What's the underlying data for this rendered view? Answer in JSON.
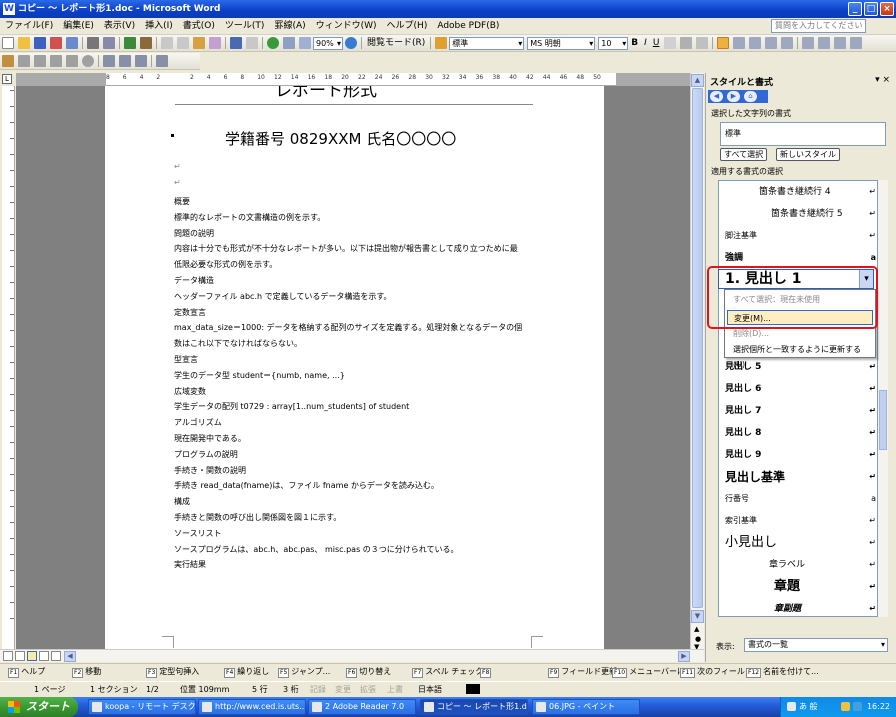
{
  "window": {
    "title": "コピー ～ レポート形1.doc - Microsoft Word"
  },
  "menubar": {
    "items": [
      "ファイル(F)",
      "編集(E)",
      "表示(V)",
      "挿入(I)",
      "書式(O)",
      "ツール(T)",
      "罫線(A)",
      "ウィンドウ(W)",
      "ヘルプ(H)",
      "Adobe PDF(B)"
    ],
    "help_placeholder": "質問を入力してください"
  },
  "toolbar": {
    "zoom": "90%",
    "reading_mode": "閲覧モード(R)",
    "style": "標準",
    "font": "MS 明朝",
    "font_size": "10",
    "bold": "B",
    "italic": "I",
    "underline": "U"
  },
  "ruler": {
    "numbers": [
      "8",
      "6",
      "4",
      "2",
      "",
      "2",
      "4",
      "6",
      "8",
      "10",
      "12",
      "14",
      "16",
      "18",
      "20",
      "22",
      "24",
      "26",
      "28",
      "30",
      "32",
      "34",
      "36",
      "38",
      "40",
      "42",
      "44",
      "46",
      "48",
      "50"
    ]
  },
  "document": {
    "title": "レポート形式",
    "subtitle": "学籍番号 0829XXM  氏名〇〇〇〇",
    "lines": [
      "概要",
      "標準的なレポートの文書構造の例を示す。",
      "問題の説明",
      "内容は十分でも形式が不十分なレポートが多い。以下は提出物が報告書として成り立つために最",
      "低限必要な形式の例を示す。",
      "データ構造",
      "ヘッダーファイル abc.h で定義しているデータ構造を示す。",
      "定数宣言",
      "max_data_size＝1000: データを格納する配列のサイズを定義する。処理対象となるデータの個",
      "数はこれ以下でなければならない。",
      "型宣言",
      "学生のデータ型  student＝{numb, name, ...}",
      "広域変数",
      "学生データの配列  t0729 : array[1..num_students] of student",
      "アルゴリズム",
      "現在開発中である。",
      "プログラムの説明",
      "手続き・関数の説明",
      "手続き read_data(fname)は、ファイル fname からデータを読み込む。",
      "構成",
      "手続きと関数の呼び出し関係図を図１に示す。",
      "ソースリスト",
      "ソースプログラムは、abc.h、abc.pas、 misc.pas の３つに分けられている。",
      "実行結果"
    ]
  },
  "pane": {
    "title": "スタイルと書式",
    "selected_label": "選択した文字列の書式",
    "selected_value": "標準",
    "select_all_btn": "すべて選択",
    "new_style_btn": "新しいスタイル",
    "apply_label": "適用する書式の選択",
    "styles": [
      {
        "name": "箇条書き継続行 4",
        "mark": "↵"
      },
      {
        "name": "箇条書き継続行 5",
        "mark": "↵"
      },
      {
        "name": "脚注基準",
        "mark": "↵"
      },
      {
        "name": "強調",
        "mark": "a"
      },
      {
        "name": "見出し 5",
        "mark": "↵"
      },
      {
        "name": "見出し 6",
        "mark": "↵"
      },
      {
        "name": "見出し 7",
        "mark": "↵"
      },
      {
        "name": "見出し 8",
        "mark": "↵"
      },
      {
        "name": "見出し 9",
        "mark": "↵"
      },
      {
        "name": "見出し基準",
        "mark": "↵"
      },
      {
        "name": "行番号",
        "mark": "a"
      },
      {
        "name": "索引基準",
        "mark": "↵"
      },
      {
        "name": "小見出し",
        "mark": "↵"
      },
      {
        "name": "章ラベル",
        "mark": "↵"
      },
      {
        "name": "章題",
        "mark": "↵"
      },
      {
        "name": "章副題",
        "mark": "↵"
      }
    ],
    "selected_style": "1. 見出し 1",
    "context_menu": {
      "select_all": "すべて選択：現在未使用",
      "change": "変更(M)...",
      "delete": "削除(D)...",
      "update": "選択個所と一致するように更新する(U)"
    },
    "show_label": "表示:",
    "show_value": "書式の一覧"
  },
  "fkeys": [
    {
      "key": "F1",
      "label": "ヘルプ"
    },
    {
      "key": "F2",
      "label": "移動"
    },
    {
      "key": "F3",
      "label": "定型句挿入"
    },
    {
      "key": "F4",
      "label": "繰り返し"
    },
    {
      "key": "F5",
      "label": "ジャンプ..."
    },
    {
      "key": "F6",
      "label": "切り替え"
    },
    {
      "key": "F7",
      "label": "スペル チェック..."
    },
    {
      "key": "F8",
      "label": ""
    },
    {
      "key": "F9",
      "label": "フィールド更新"
    },
    {
      "key": "F10",
      "label": "メニューバーに"
    },
    {
      "key": "F11",
      "label": "次のフィールド"
    },
    {
      "key": "F12",
      "label": "名前を付けて..."
    }
  ],
  "status": {
    "page": "1 ページ",
    "section": "1 セクション",
    "pages": "1/2",
    "position": "位置 109mm",
    "line": "5 行",
    "col": "3 桁",
    "rec": "記録",
    "trk": "変更",
    "ext": "拡張",
    "ovr": "上書",
    "lang": "日本語"
  },
  "taskbar": {
    "start": "スタート",
    "tasks": [
      "koopa - リモート デスク...",
      "http://www.ced.is.uts...",
      "2 Adobe Reader 7.0",
      "コピー ～ レポート形1.d...",
      "06.JPG - ペイント"
    ],
    "ime": "あ 般",
    "clock": "16:22"
  },
  "colors": {
    "title_blue": "#0a3fc6",
    "highlight_red": "#e0141e",
    "menu_hover": "#ffeec2"
  }
}
